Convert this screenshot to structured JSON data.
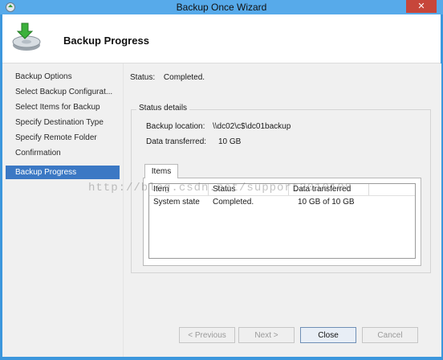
{
  "window": {
    "title": "Backup Once Wizard",
    "close_glyph": "✕",
    "app_icon": "backup-app-icon"
  },
  "header": {
    "title": "Backup Progress",
    "icon": "backup-disk-arrow-icon"
  },
  "nav": {
    "items": [
      {
        "label": "Backup Options",
        "active": false
      },
      {
        "label": "Select Backup Configurat...",
        "active": false
      },
      {
        "label": "Select Items for Backup",
        "active": false
      },
      {
        "label": "Specify Destination Type",
        "active": false
      },
      {
        "label": "Specify Remote Folder",
        "active": false
      },
      {
        "label": "Confirmation",
        "active": false
      },
      {
        "label": "Backup Progress",
        "active": true
      }
    ]
  },
  "status": {
    "label": "Status:",
    "value": "Completed."
  },
  "details": {
    "legend": "Status details",
    "location_label": "Backup location:",
    "location_value": "\\\\dc02\\c$\\dc01backup",
    "transferred_label": "Data transferred:",
    "transferred_value": "10 GB",
    "tab_label": "Items",
    "columns": [
      "Item",
      "Status",
      "Data transferred"
    ],
    "rows": [
      {
        "item": "System state",
        "status": "Completed.",
        "transferred": "10 GB of 10 GB"
      }
    ]
  },
  "buttons": {
    "previous": "< Previous",
    "next": "Next >",
    "close": "Close",
    "cancel": "Cancel"
  },
  "watermark": "http://blog.csdn.net/support2010108"
}
